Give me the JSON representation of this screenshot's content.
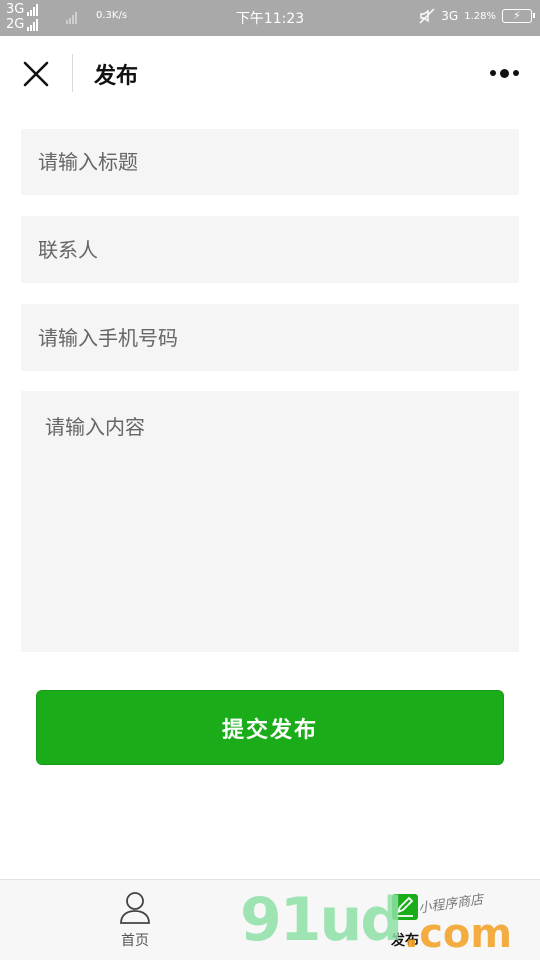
{
  "status_bar": {
    "net1": "3G",
    "net2": "2G",
    "speed": "0.3K/s",
    "time": "下午11:23",
    "right_net": "3G",
    "data_rate": "1.28%"
  },
  "navbar": {
    "title": "发布"
  },
  "form": {
    "title_placeholder": "请输入标题",
    "contact_placeholder": "联系人",
    "phone_placeholder": "请输入手机号码",
    "content_placeholder": "请输入内容",
    "submit_label": "提交发布"
  },
  "tabbar": {
    "items": [
      {
        "label": "首页",
        "icon": "user-icon"
      },
      {
        "label": "发布",
        "icon": "edit-icon"
      }
    ],
    "active_color": "#1aad19"
  },
  "watermark": {
    "main": "91ud",
    "suffix": ".com",
    "sub": "小程序商店"
  },
  "colors": {
    "status_bar_bg": "#a9a9a9",
    "primary_button": "#1aad19",
    "field_bg": "#f5f5f5"
  }
}
